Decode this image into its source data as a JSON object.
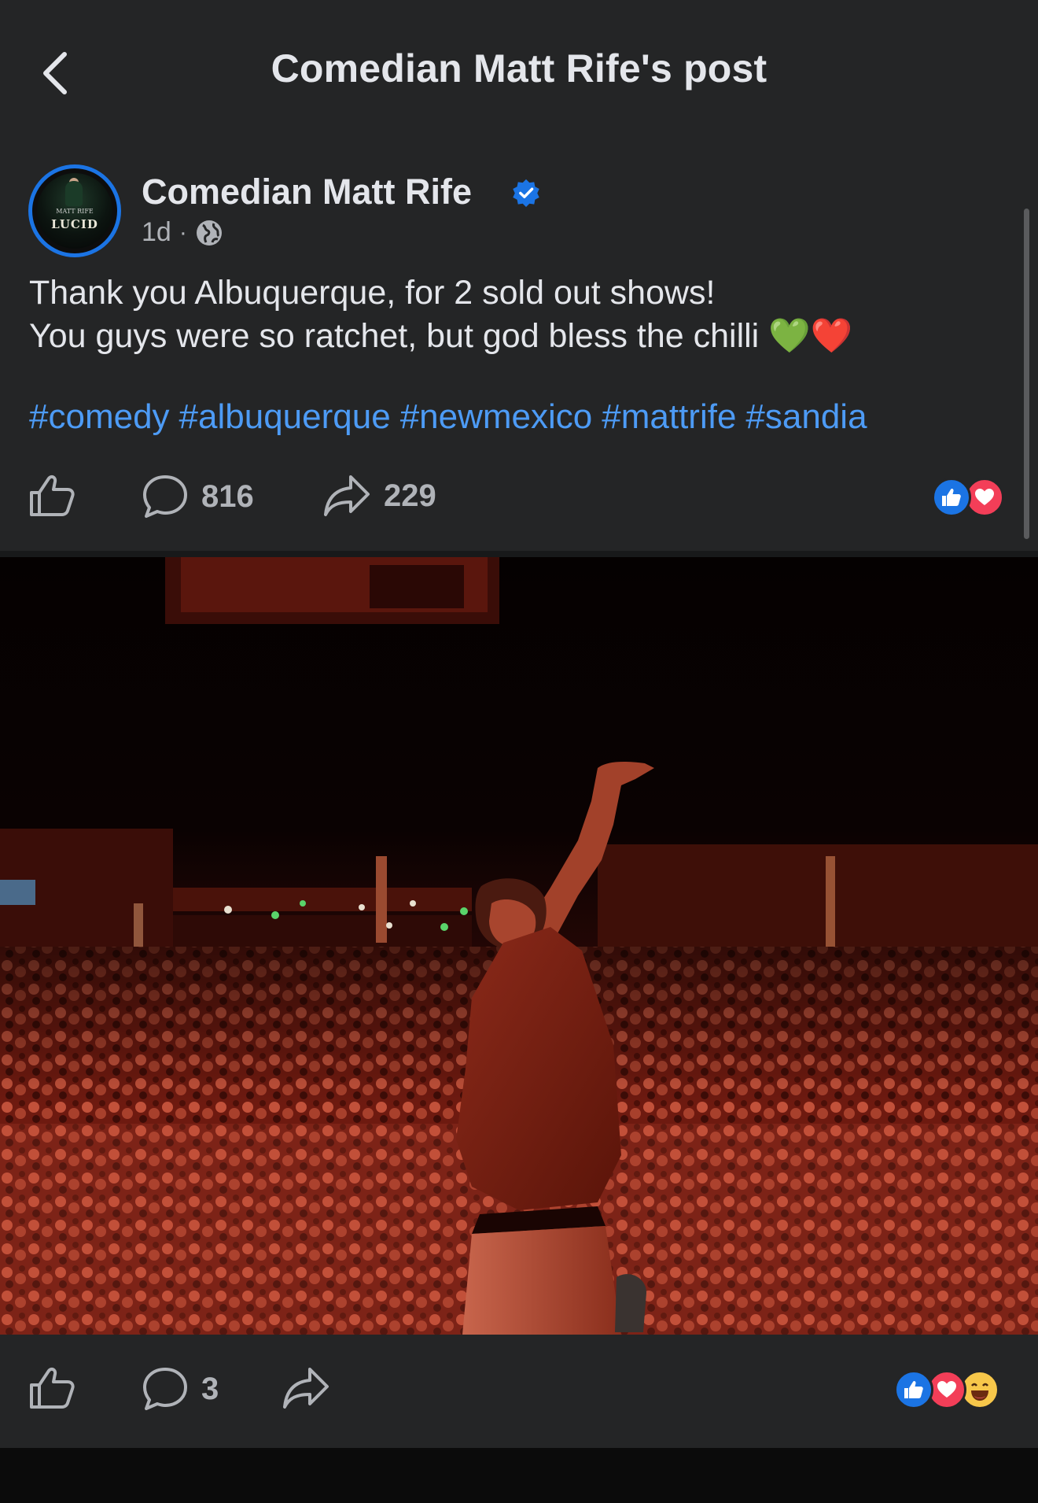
{
  "header": {
    "title": "Comedian Matt Rife's post",
    "back_icon": "chevron-left-icon"
  },
  "post": {
    "author": {
      "name": "Comedian Matt Rife",
      "verified": true,
      "avatar": {
        "brand": "MATT RIFE",
        "title": "LUCID"
      }
    },
    "time": "1d",
    "separator": "·",
    "audience_icon": "globe-icon",
    "text_lines": [
      "Thank you Albuquerque, for 2 sold out shows!",
      "You guys were so ratchet, but god bless the chilli 💚❤️"
    ],
    "hashtags": [
      "#comedy",
      "#albuquerque",
      "#newmexico",
      "#mattrife",
      "#sandia"
    ],
    "actions": {
      "comments": "816",
      "shares": "229",
      "reactions": [
        "like",
        "love"
      ]
    }
  },
  "photo_post": {
    "actions": {
      "comments": "3",
      "reactions": [
        "like",
        "love",
        "haha"
      ]
    }
  },
  "colors": {
    "background": "#242526",
    "hashtag": "#4d9bf5",
    "like": "#1b74e4",
    "love": "#f33e58",
    "verified": "#1b74e4"
  }
}
